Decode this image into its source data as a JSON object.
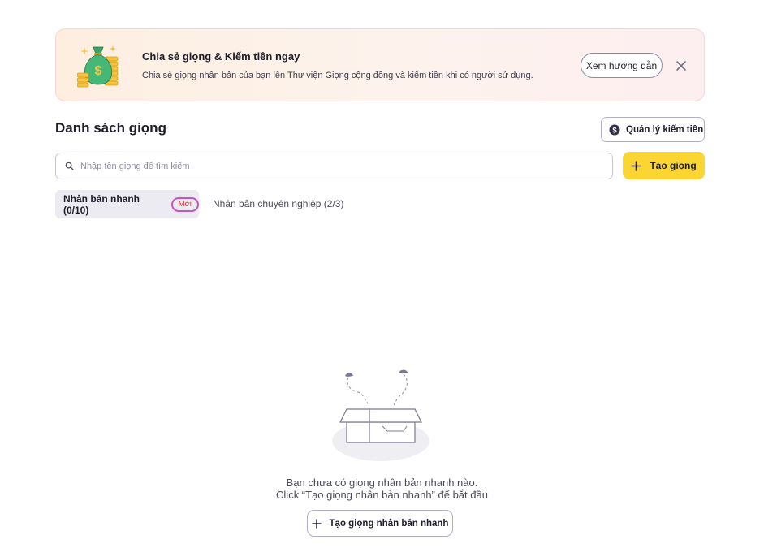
{
  "banner": {
    "title": "Chia sẻ giọng & Kiếm tiền ngay",
    "description": "Chia sẻ giọng nhân bản của bạn lên Thư viện Giọng cộng đồng và kiếm tiền khi có người sử dụng.",
    "guide_label": "Xem hướng dẫn",
    "illustration_icon": "money-bag-coins-icon",
    "close_icon": "close-icon"
  },
  "header": {
    "title": "Danh sách giọng",
    "manage_label": "Quản lý kiếm tiền",
    "manage_icon": "dollar-circle-icon"
  },
  "search": {
    "placeholder": "Nhập tên giọng để tìm kiếm",
    "value": "",
    "icon": "search-icon"
  },
  "create_button": {
    "label": "Tạo giọng",
    "icon": "plus-icon"
  },
  "tabs": [
    {
      "label": "Nhân bản nhanh (0/10)",
      "badge": "Mới",
      "active": true
    },
    {
      "label": "Nhân bản chuyên nghiệp (2/3)",
      "active": false
    }
  ],
  "empty_state": {
    "line1": "Bạn chưa có giọng nhân bản nhanh nào.",
    "line2": "Click “Tạo giọng nhân bản nhanh” để bắt đầu",
    "button_label": "Tạo giọng nhân bản nhanh",
    "illustration_icon": "empty-box-icon"
  },
  "colors": {
    "accent_yellow": "#fbd531",
    "banner_bg": "#fdf0e6",
    "badge_border": "#c553c9",
    "badge_text": "#d0363e",
    "tab_active_bg": "#ecebf2"
  }
}
